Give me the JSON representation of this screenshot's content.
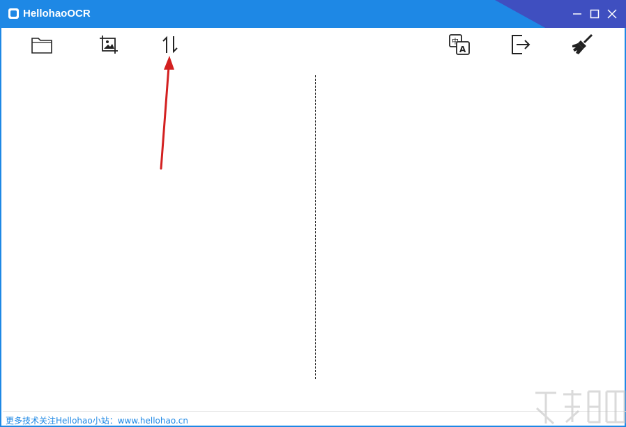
{
  "window": {
    "title": "HellohaoOCR"
  },
  "toolbar": {
    "left_items": [
      {
        "name": "open-folder",
        "icon": "folder-icon"
      },
      {
        "name": "screenshot",
        "icon": "crop-image-icon"
      },
      {
        "name": "sort",
        "icon": "up-down-arrows-icon"
      }
    ],
    "right_items": [
      {
        "name": "translate",
        "icon": "translate-icon"
      },
      {
        "name": "export",
        "icon": "exit-icon"
      },
      {
        "name": "clear",
        "icon": "broom-icon"
      }
    ]
  },
  "annotation": {
    "color": "#d32020",
    "target": "sort"
  },
  "status": {
    "text": "更多技术关注Hellohao小站：www.hellohao.cn"
  },
  "colors": {
    "titlebar": "#1e88e5",
    "titlebar_accent": "#3f4fc0",
    "status_text": "#1e88e5"
  }
}
